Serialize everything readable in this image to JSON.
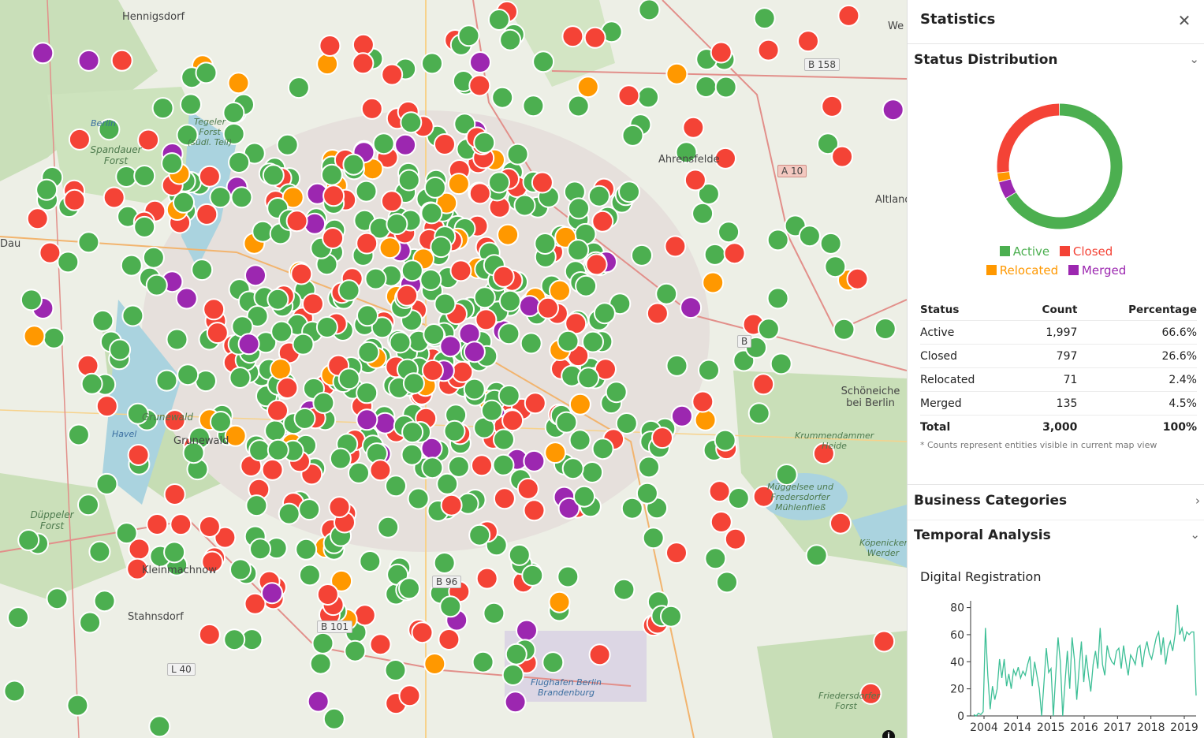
{
  "map": {
    "place_labels": [
      "Hennigsdorf",
      "Spandauer Forst",
      "Tegeler Forst (südl. Teil)",
      "Grunewald",
      "Grunewald",
      "Düppeler Forst",
      "Stahnsdorf",
      "Kleinmachnow",
      "Ahrensfelde",
      "Altlandsberg",
      "Schöneiche bei Berlin",
      "Krummendammer Heide",
      "Müggelsee und Fredersdorfer Mühlenfließ",
      "Flughafen Berlin Brandenburg",
      "Friedersdorfer Forst",
      "Köpenicker Werder",
      "Havel",
      "Berlin",
      "Dau",
      "We"
    ],
    "road_shields": [
      "B 158",
      "A 10",
      "B 96",
      "B 101",
      "L 40",
      "B"
    ],
    "info_icon": "info-icon",
    "colors": {
      "active": "#4caf50",
      "closed": "#f44336",
      "relocated": "#ff9800",
      "merged": "#9c27b0"
    }
  },
  "panel": {
    "title": "Statistics",
    "close_icon": "close-icon",
    "status_section": {
      "title": "Status Distribution",
      "legend": [
        "Active",
        "Closed",
        "Relocated",
        "Merged"
      ],
      "table": {
        "headers": [
          "Status",
          "Count",
          "Percentage"
        ],
        "rows": [
          {
            "status": "Active",
            "count": "1,997",
            "pct": "66.6%"
          },
          {
            "status": "Closed",
            "count": "797",
            "pct": "26.6%"
          },
          {
            "status": "Relocated",
            "count": "71",
            "pct": "2.4%"
          },
          {
            "status": "Merged",
            "count": "135",
            "pct": "4.5%"
          }
        ],
        "total": {
          "label": "Total",
          "count": "3,000",
          "pct": "100%"
        }
      },
      "note": "* Counts represent entities visible in current map view"
    },
    "business_section": {
      "title": "Business Categories"
    },
    "temporal_section": {
      "title": "Temporal Analysis",
      "subtitle": "Digital Registration"
    }
  },
  "chart_data": [
    {
      "type": "pie",
      "categories": [
        "Active",
        "Closed",
        "Relocated",
        "Merged"
      ],
      "values": [
        1997,
        797,
        71,
        135
      ],
      "colors": [
        "#4caf50",
        "#f44336",
        "#ff9800",
        "#9c27b0"
      ],
      "title": "",
      "legend": "bottom"
    },
    {
      "type": "line",
      "title": "Digital Registration",
      "xlabel": "",
      "ylabel": "",
      "x_tick_labels": [
        "2004",
        "2014",
        "2015",
        "2016",
        "2017",
        "2018",
        "2019"
      ],
      "y_ticks": [
        0,
        20,
        40,
        60,
        80
      ],
      "ylim": [
        0,
        85
      ],
      "series": [
        {
          "color": "#3dbf96",
          "values": [
            1,
            0,
            2,
            1,
            3,
            65,
            30,
            5,
            22,
            12,
            20,
            42,
            28,
            42,
            22,
            31,
            20,
            34,
            30,
            36,
            28,
            33,
            30,
            38,
            44,
            22,
            40,
            30,
            20,
            0,
            25,
            50,
            32,
            35,
            0,
            30,
            58,
            40,
            0,
            25,
            48,
            20,
            58,
            42,
            12,
            35,
            55,
            25,
            45,
            30,
            18,
            38,
            48,
            35,
            65,
            38,
            30,
            52,
            44,
            40,
            38,
            48,
            50,
            35,
            52,
            40,
            30,
            45,
            42,
            38,
            50,
            52,
            36,
            48,
            55,
            46,
            42,
            50,
            58,
            62,
            45,
            58,
            38,
            50,
            55,
            48,
            60,
            82,
            60,
            65,
            55,
            62,
            60,
            62,
            62,
            15
          ]
        }
      ]
    }
  ]
}
